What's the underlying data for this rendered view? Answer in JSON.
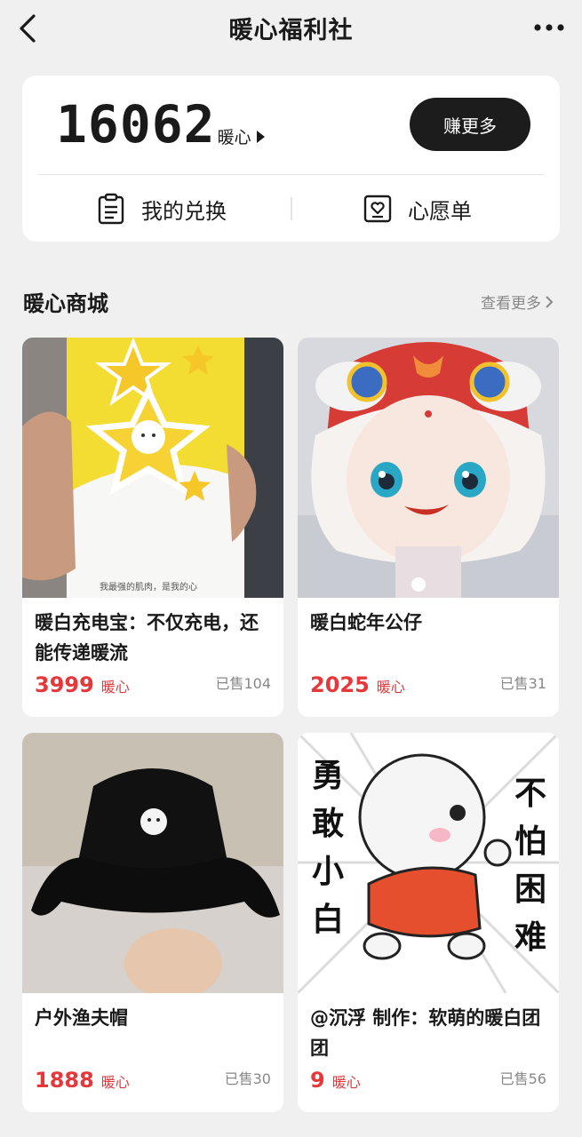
{
  "nav": {
    "title": "暖心福利社",
    "back_icon": "chevron-left-icon",
    "more_icon": "ellipsis-icon"
  },
  "balance": {
    "value": "16062",
    "unit": "暖心",
    "earn_button": "赚更多",
    "my_exchange": "我的兑换",
    "wishlist": "心愿单"
  },
  "section": {
    "title": "暖心商城",
    "see_more": "查看更多"
  },
  "products": [
    {
      "title": "暖白充电宝：不仅充电，还能传递暖流",
      "price": "3999",
      "unit": "暖心",
      "sold": "已售104",
      "image_caption": "我最强的肌肉，是我的心"
    },
    {
      "title": "暖白蛇年公仔",
      "price": "2025",
      "unit": "暖心",
      "sold": "已售31"
    },
    {
      "title": "户外渔夫帽",
      "price": "1888",
      "unit": "暖心",
      "sold": "已售30"
    },
    {
      "title": "@沉浮 制作：软萌的暖白团团",
      "price": "9",
      "unit": "暖心",
      "sold": "已售56",
      "image_text_left": "勇敢小白",
      "image_text_right": "不怕困难"
    }
  ],
  "colors": {
    "accent": "#e5383b",
    "dark_button": "#1c1c1c",
    "background": "#f0f0f0"
  }
}
